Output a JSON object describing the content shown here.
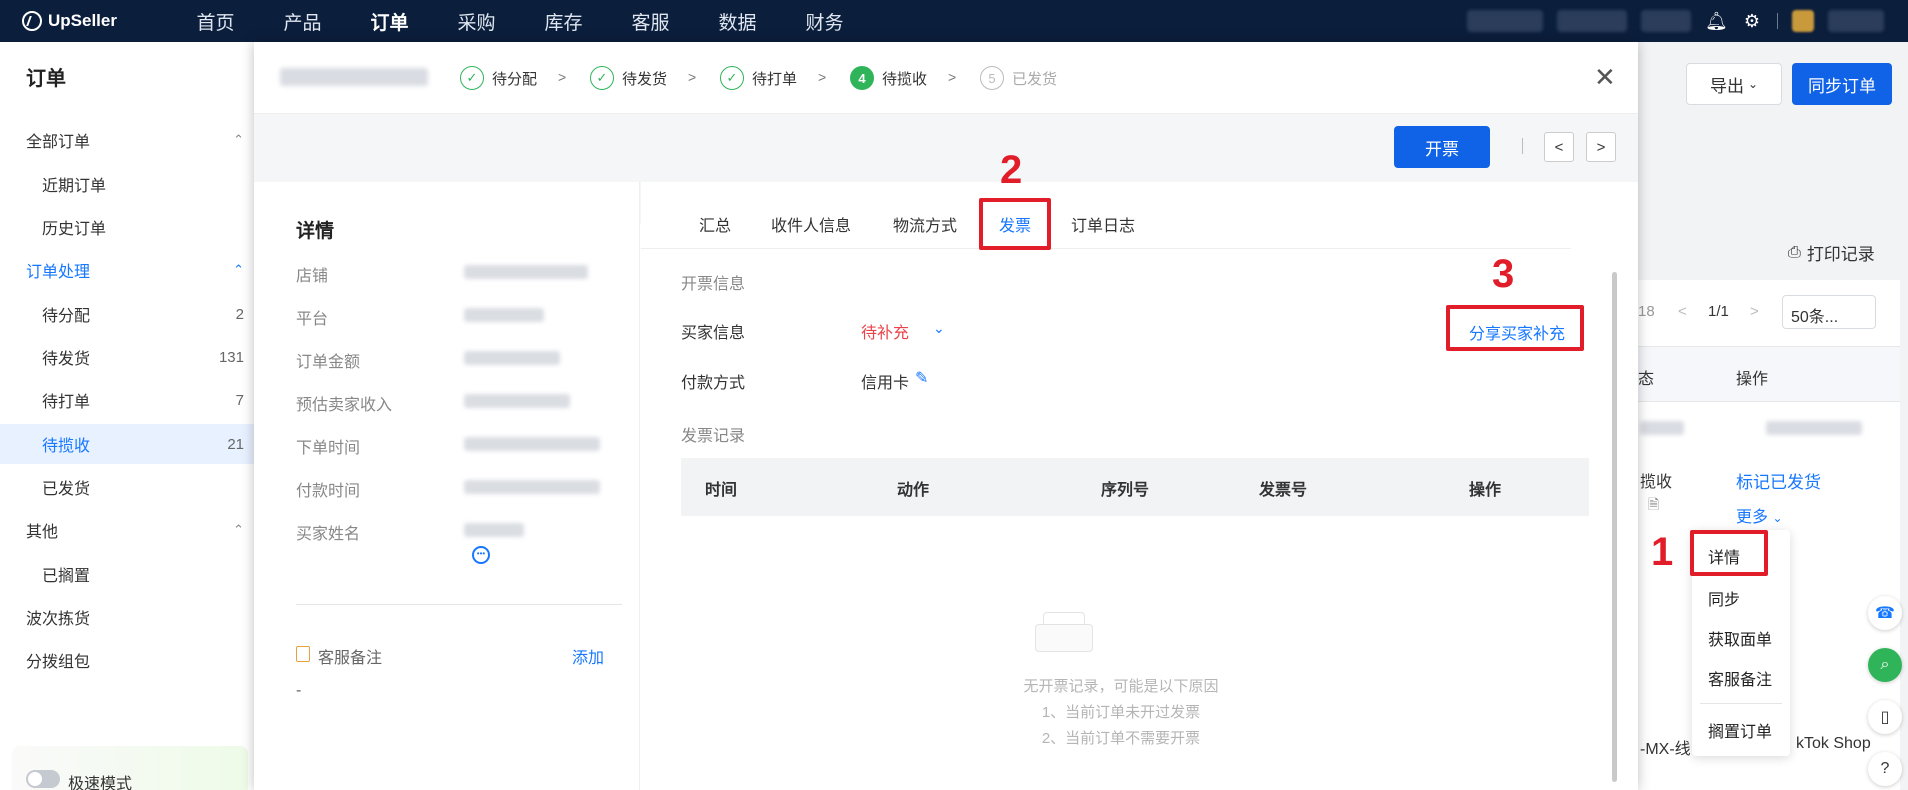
{
  "topnav": {
    "brand": "UpSeller",
    "items": [
      "首页",
      "产品",
      "订单",
      "采购",
      "库存",
      "客服",
      "数据",
      "财务"
    ],
    "active": "订单"
  },
  "sidebar": {
    "title": "订单",
    "rows": [
      {
        "label": "全部订单",
        "type": "group",
        "chev": "^"
      },
      {
        "label": "近期订单",
        "type": "sub"
      },
      {
        "label": "历史订单",
        "type": "sub"
      },
      {
        "label": "订单处理",
        "type": "group-blue",
        "chev": "^"
      },
      {
        "label": "待分配",
        "type": "sub",
        "count": "2"
      },
      {
        "label": "待发货",
        "type": "sub",
        "count": "131"
      },
      {
        "label": "待打单",
        "type": "sub",
        "count": "7"
      },
      {
        "label": "待揽收",
        "type": "selected",
        "count": "21"
      },
      {
        "label": "已发货",
        "type": "sub"
      },
      {
        "label": "其他",
        "type": "group",
        "chev": "^"
      },
      {
        "label": "已搁置",
        "type": "sub"
      },
      {
        "label": "波次拣货",
        "type": "group"
      },
      {
        "label": "分拨组包",
        "type": "group"
      }
    ],
    "speed_mode": "极速模式"
  },
  "background": {
    "export_label": "导出",
    "sync_label": "同步订单",
    "print_records": "打印记录",
    "pager_total": "18",
    "pager_page": "1/1",
    "page_size": "50条...",
    "col_status": "态",
    "col_action": "操作",
    "row_status": "揽收",
    "mark_shipped": "标记已发货",
    "more": "更多",
    "row2_left": "-MX-线",
    "row2_right": "kTok Shop"
  },
  "more_menu": [
    "详情",
    "同步",
    "获取面单",
    "客服备注",
    "搁置订单"
  ],
  "modal": {
    "steps": [
      {
        "label": "待分配",
        "state": "done"
      },
      {
        "label": "待发货",
        "state": "done"
      },
      {
        "label": "待打单",
        "state": "done"
      },
      {
        "label": "待揽收",
        "state": "current",
        "num": "4"
      },
      {
        "label": "已发货",
        "state": "todo",
        "num": "5"
      }
    ],
    "invoice_button": "开票",
    "prev": "<",
    "next": ">",
    "detail": {
      "title": "详情",
      "labels": [
        "店铺",
        "平台",
        "订单金额",
        "预估卖家收入",
        "下单时间",
        "付款时间",
        "买家姓名"
      ],
      "note_label": "客服备注",
      "note_add": "添加",
      "note_value": "-"
    },
    "tabs": [
      "汇总",
      "收件人信息",
      "物流方式",
      "发票",
      "订单日志"
    ],
    "active_tab": "发票",
    "invoice": {
      "section_info": "开票信息",
      "buyer_label": "买家信息",
      "buyer_value": "待补充",
      "share_link": "分享买家补充",
      "payment_label": "付款方式",
      "payment_value": "信用卡",
      "records_title": "发票记录",
      "columns": [
        "时间",
        "动作",
        "序列号",
        "发票号",
        "操作"
      ],
      "empty_lines": [
        "无开票记录，可能是以下原因",
        "1、当前订单未开过发票",
        "2、当前订单不需要开票"
      ]
    }
  },
  "annotations": [
    "1",
    "2",
    "3"
  ]
}
